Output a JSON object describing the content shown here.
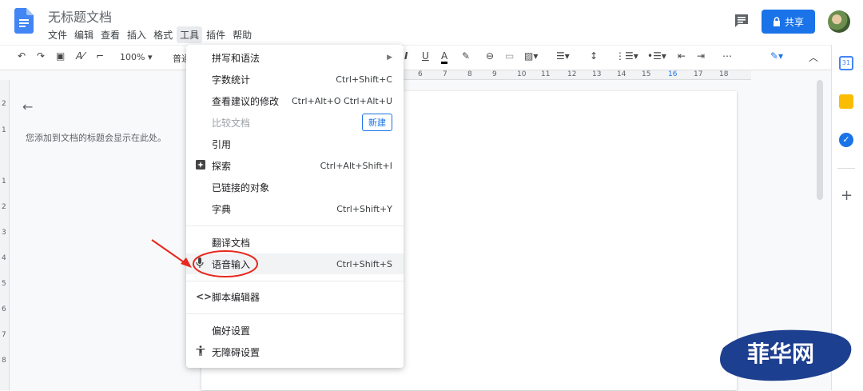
{
  "doc": {
    "title": "无标题文档"
  },
  "menu_bar": [
    "文件",
    "编辑",
    "查看",
    "插入",
    "格式",
    "工具",
    "插件",
    "帮助"
  ],
  "share_label": "共享",
  "toolbar": {
    "zoom": "100%",
    "style": "普通"
  },
  "outline": {
    "hint": "您添加到文档的标题会显示在此处。"
  },
  "ruler_h": [
    "6",
    "7",
    "8",
    "9",
    "10",
    "11",
    "12",
    "13",
    "14",
    "15",
    "16",
    "17",
    "18"
  ],
  "ruler_v": [
    "2",
    "1",
    "1",
    "2",
    "3",
    "4",
    "5",
    "6",
    "7",
    "8"
  ],
  "tools_menu": [
    {
      "label": "拼写和语法",
      "shortcut": "",
      "submenu": true
    },
    {
      "label": "字数统计",
      "shortcut": "Ctrl+Shift+C"
    },
    {
      "label": "查看建议的修改",
      "shortcut": "Ctrl+Alt+O Ctrl+Alt+U"
    },
    {
      "label": "比较文档",
      "badge": "新建",
      "disabled": true
    },
    {
      "label": "引用",
      "shortcut": ""
    },
    {
      "label": "探索",
      "shortcut": "Ctrl+Alt+Shift+I",
      "icon": "explore-icon"
    },
    {
      "label": "已链接的对象",
      "shortcut": ""
    },
    {
      "label": "字典",
      "shortcut": "Ctrl+Shift+Y"
    },
    {
      "label": "翻译文档",
      "shortcut": ""
    },
    {
      "label": "语音输入",
      "shortcut": "Ctrl+Shift+S",
      "icon": "mic-icon",
      "highlighted": true
    },
    {
      "label": "脚本编辑器",
      "shortcut": "",
      "icon": "code-icon"
    },
    {
      "label": "偏好设置",
      "shortcut": ""
    },
    {
      "label": "无障碍设置",
      "shortcut": "",
      "icon": "accessibility-icon"
    }
  ],
  "watermark": "菲华网",
  "colors": {
    "accent": "#1a73e8",
    "annotation": "#e8281e",
    "doc_icon": "#4285f4"
  }
}
